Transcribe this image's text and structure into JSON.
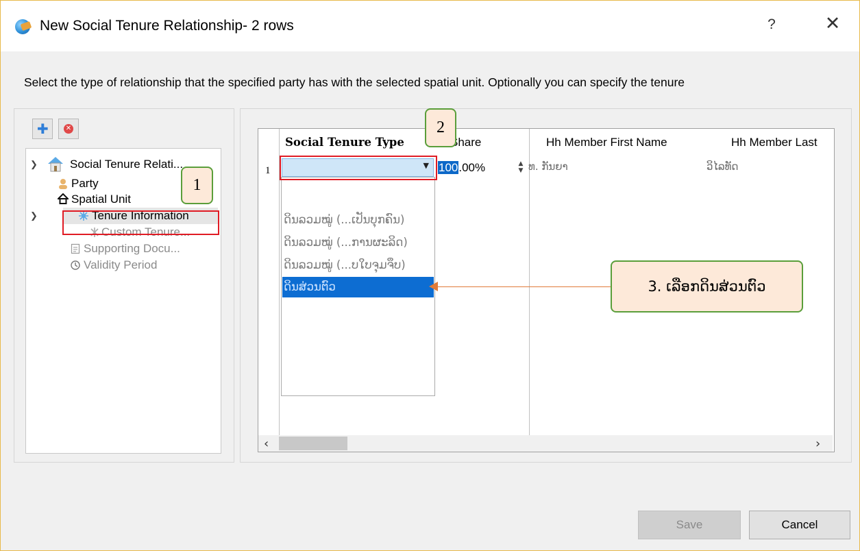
{
  "window": {
    "title": "New Social Tenure Relationship- 2 rows",
    "help_glyph": "?",
    "close_glyph": "✕",
    "instruction": "Select the type of relationship that the specified party has with the selected spatial unit. Optionally you can specify the tenure"
  },
  "toolbar": {
    "add_icon": "plus-icon",
    "remove_icon": "remove-icon"
  },
  "tree": {
    "items": [
      {
        "label": "Social Tenure Relati...",
        "icon": "house-icon"
      },
      {
        "label": "Party",
        "icon": "person-icon"
      },
      {
        "label": "Spatial Unit",
        "icon": "home-icon"
      },
      {
        "label": "Tenure Information",
        "icon": "tenure-icon"
      },
      {
        "label": "Custom Tenure...",
        "icon": "custom-icon"
      },
      {
        "label": "Supporting Docu...",
        "icon": "document-icon"
      },
      {
        "label": "Validity Period",
        "icon": "clock-icon"
      }
    ]
  },
  "grid": {
    "columns": [
      "Social Tenure Type",
      "Share",
      "Hh Member First Name",
      "Hh Member Last"
    ],
    "row_number": "1",
    "share_selected": "100",
    "share_rest": ".00%",
    "first_name": "ທ. ກັນຍາ",
    "last_name": "ວິໄລທັດ",
    "dropdown_options": [
      "ດິນລວມໝູ່ (...ເປັນບຸກຄົນ)",
      "ດິນລວມໝູ່ (...ການຜະລິດ)",
      "ດິນລວມໝູ່ (...ບໃບຈຸມຈຶບ)",
      "ດິນສ່ວນຕົວ"
    ]
  },
  "callouts": {
    "step1": "1",
    "step2": "2",
    "step3": "3. ເລືອກດິນສ່ວນຕົວ"
  },
  "buttons": {
    "save": "Save",
    "cancel": "Cancel"
  },
  "colors": {
    "highlight_red": "#e01b24",
    "selection_blue": "#0d6dd2",
    "callout_fill": "#fde9d9",
    "callout_border": "#5a9e3a",
    "arrow": "#e07b39"
  }
}
